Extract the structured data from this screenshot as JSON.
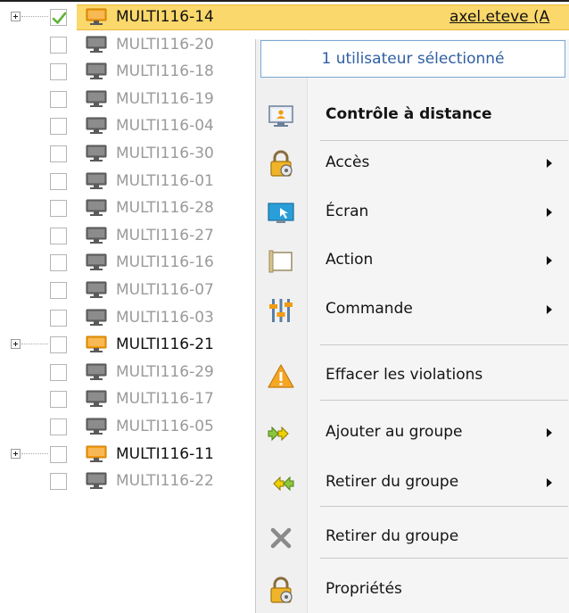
{
  "tree": {
    "rows": [
      {
        "name": "MULTI116-14",
        "expander": true,
        "checked": true,
        "active": true,
        "selected": true,
        "user": "axel.eteve (A"
      },
      {
        "name": "MULTI116-20",
        "expander": false,
        "checked": false,
        "active": false,
        "selected": false
      },
      {
        "name": "MULTI116-18",
        "expander": false,
        "checked": false,
        "active": false,
        "selected": false
      },
      {
        "name": "MULTI116-19",
        "expander": false,
        "checked": false,
        "active": false,
        "selected": false
      },
      {
        "name": "MULTI116-04",
        "expander": false,
        "checked": false,
        "active": false,
        "selected": false
      },
      {
        "name": "MULTI116-30",
        "expander": false,
        "checked": false,
        "active": false,
        "selected": false
      },
      {
        "name": "MULTI116-01",
        "expander": false,
        "checked": false,
        "active": false,
        "selected": false
      },
      {
        "name": "MULTI116-28",
        "expander": false,
        "checked": false,
        "active": false,
        "selected": false
      },
      {
        "name": "MULTI116-27",
        "expander": false,
        "checked": false,
        "active": false,
        "selected": false
      },
      {
        "name": "MULTI116-16",
        "expander": false,
        "checked": false,
        "active": false,
        "selected": false
      },
      {
        "name": "MULTI116-07",
        "expander": false,
        "checked": false,
        "active": false,
        "selected": false
      },
      {
        "name": "MULTI116-03",
        "expander": false,
        "checked": false,
        "active": false,
        "selected": false
      },
      {
        "name": "MULTI116-21",
        "expander": true,
        "checked": false,
        "active": true,
        "selected": false
      },
      {
        "name": "MULTI116-29",
        "expander": false,
        "checked": false,
        "active": false,
        "selected": false
      },
      {
        "name": "MULTI116-17",
        "expander": false,
        "checked": false,
        "active": false,
        "selected": false
      },
      {
        "name": "MULTI116-05",
        "expander": false,
        "checked": false,
        "active": false,
        "selected": false
      },
      {
        "name": "MULTI116-11",
        "expander": true,
        "checked": false,
        "active": true,
        "selected": false
      },
      {
        "name": "MULTI116-22",
        "expander": false,
        "checked": false,
        "active": false,
        "selected": false
      }
    ]
  },
  "context_menu": {
    "header": "1 utilisateur sélectionné",
    "items": [
      {
        "label": "Contrôle à distance",
        "bold": true,
        "submenu": false,
        "icon": "remote-control-icon"
      },
      {
        "label": "Accès",
        "bold": false,
        "submenu": true,
        "icon": "access-lock-icon"
      },
      {
        "label": "Écran",
        "bold": false,
        "submenu": true,
        "icon": "screen-icon"
      },
      {
        "label": "Action",
        "bold": false,
        "submenu": true,
        "icon": "action-icon"
      },
      {
        "label": "Commande",
        "bold": false,
        "submenu": true,
        "icon": "sliders-icon"
      },
      {
        "label": "Effacer les violations",
        "bold": false,
        "submenu": false,
        "icon": "warning-icon"
      },
      {
        "label": "Ajouter au groupe",
        "bold": false,
        "submenu": true,
        "icon": "add-group-arrows-icon"
      },
      {
        "label": "Retirer du groupe",
        "bold": false,
        "submenu": true,
        "icon": "remove-group-arrows-icon"
      },
      {
        "label": "Retirer du groupe",
        "bold": false,
        "submenu": false,
        "icon": "close-x-icon"
      },
      {
        "label": "Propriétés",
        "bold": false,
        "submenu": false,
        "icon": "properties-lock-icon"
      }
    ]
  },
  "colors": {
    "selection": "#fbd86b",
    "active_monitor": "#f39c12",
    "inactive_monitor": "#6e6e6e",
    "header_text": "#2f5fa3",
    "check_green": "#5fb43a"
  }
}
